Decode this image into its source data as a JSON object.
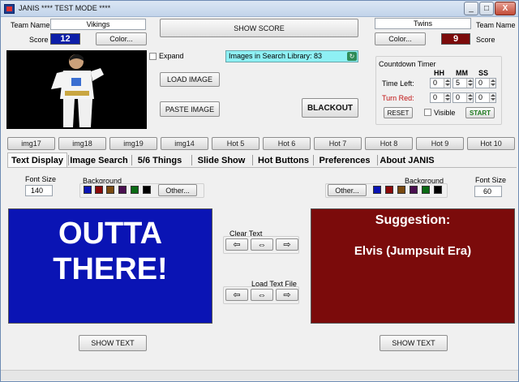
{
  "window": {
    "title": "JANIS    **** TEST MODE ****",
    "minimize": "_",
    "maximize": "□",
    "close": "X"
  },
  "left_team": {
    "name_label": "Team Name",
    "name_value": "Vikings",
    "score_label": "Score",
    "score_value": "12",
    "color_button": "Color...",
    "score_color": "#0d1fa8"
  },
  "right_team": {
    "name_label": "Team Name",
    "name_value": "Twins",
    "score_label": "Score",
    "score_value": "9",
    "color_button": "Color...",
    "score_color": "#7b0b0b"
  },
  "show_score": "SHOW SCORE",
  "expand_label": "Expand",
  "load_image": "LOAD IMAGE",
  "paste_image": "PASTE IMAGE",
  "blackout": "BLACKOUT",
  "search_library": "Images in Search Library: 83",
  "countdown": {
    "title": "Countdown Timer",
    "col_hh": "HH",
    "col_mm": "MM",
    "col_ss": "SS",
    "time_left_label": "Time Left:",
    "time_left": [
      "0",
      "5",
      "0"
    ],
    "turn_red_label": "Turn Red:",
    "turn_red": [
      "0",
      "0",
      "0"
    ],
    "reset": "RESET",
    "visible": "Visible",
    "start": "START"
  },
  "slots": [
    "img17",
    "img18",
    "img19",
    "img14",
    "Hot 5",
    "Hot 6",
    "Hot 7",
    "Hot 8",
    "Hot 9",
    "Hot 10"
  ],
  "tabs": [
    "Text Display",
    "Image Search",
    "5/6 Things",
    "Slide Show",
    "Hot Buttons",
    "Preferences",
    "About JANIS"
  ],
  "left_panel": {
    "font_size_label": "Font Size",
    "font_size": "140",
    "background_label": "Background",
    "other_button": "Other...",
    "text_lines": [
      "OUTTA",
      "THERE!"
    ],
    "bg": "#0a14b4",
    "show_text": "SHOW TEXT"
  },
  "right_panel": {
    "font_size_label": "Font Size",
    "font_size": "60",
    "background_label": "Background",
    "other_button": "Other...",
    "text_line1": "Suggestion:",
    "text_line2": "Elvis (Jumpsuit Era)",
    "bg": "#7b0b0b",
    "show_text": "SHOW TEXT"
  },
  "swatches": [
    "#0a14b4",
    "#8a0a0a",
    "#7a4a10",
    "#4a1050",
    "#0a6a14",
    "#000000"
  ],
  "clear_text_label": "Clear Text",
  "load_text_label": "Load Text File",
  "arrows": [
    "⇦",
    "⇔",
    "⇨"
  ]
}
